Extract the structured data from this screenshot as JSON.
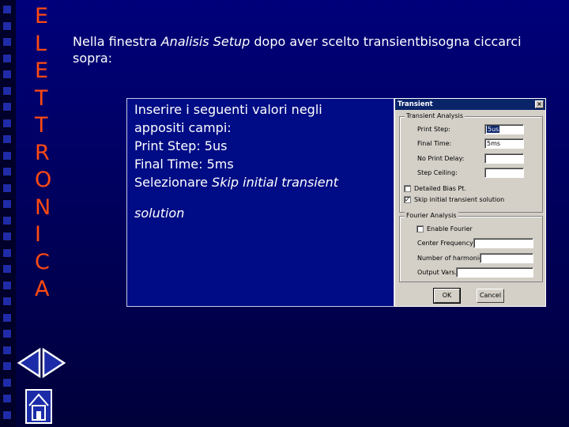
{
  "side_word": [
    "E",
    "L",
    "E",
    "T",
    "T",
    "R",
    "O",
    "N",
    "I",
    "C",
    "A"
  ],
  "intro": {
    "prefix": "Nella finestra ",
    "emphasis": "Analisis Setup",
    "suffix": " dopo aver scelto transientbisogna ciccarci sopra:"
  },
  "panel": {
    "line1_words": [
      "Inserire",
      "i",
      "seguenti",
      "valori negli"
    ],
    "line2": "appositi campi:",
    "line3": "Print Step: 5us",
    "line4": "Final Time: 5ms",
    "line5_prefix": "Selezionare ",
    "line5_emphasis": "Skip initial transient",
    "line6": "solution"
  },
  "dialog": {
    "title": "Transient",
    "close_glyph": "×",
    "group1_title": "Transient Analysis",
    "print_step_label": "Print Step:",
    "print_step_value": "5us",
    "final_time_label": "Final Time:",
    "final_time_value": "5ms",
    "no_print_delay_label": "No Print Delay:",
    "no_print_delay_value": "",
    "step_ceiling_label": "Step Ceiling:",
    "step_ceiling_value": "",
    "detailed_bias_label": "Detailed Bias Pt.",
    "detailed_bias_checked": false,
    "skip_initial_label": "Skip initial transient solution",
    "skip_initial_checked": true,
    "check_glyph": "✓",
    "group2_title": "Fourier Analysis",
    "enable_fourier_label": "Enable Fourier",
    "enable_fourier_checked": false,
    "center_freq_label": "Center Frequency:",
    "center_freq_value": "",
    "harmonics_label": "Number of harmonics:",
    "harmonics_value": "",
    "output_vars_label": "Output Vars.:",
    "output_vars_value": "",
    "ok_label": "OK",
    "cancel_label": "Cancel"
  },
  "colors": {
    "background": "#000070",
    "side_letters": "#ff4a12",
    "text": "#ffffff",
    "titlebar": "#0a246a",
    "dialog_face": "#d4d0c8"
  },
  "icons": {
    "back": "triangle-left-icon",
    "forward": "triangle-right-icon",
    "home": "home-icon"
  }
}
